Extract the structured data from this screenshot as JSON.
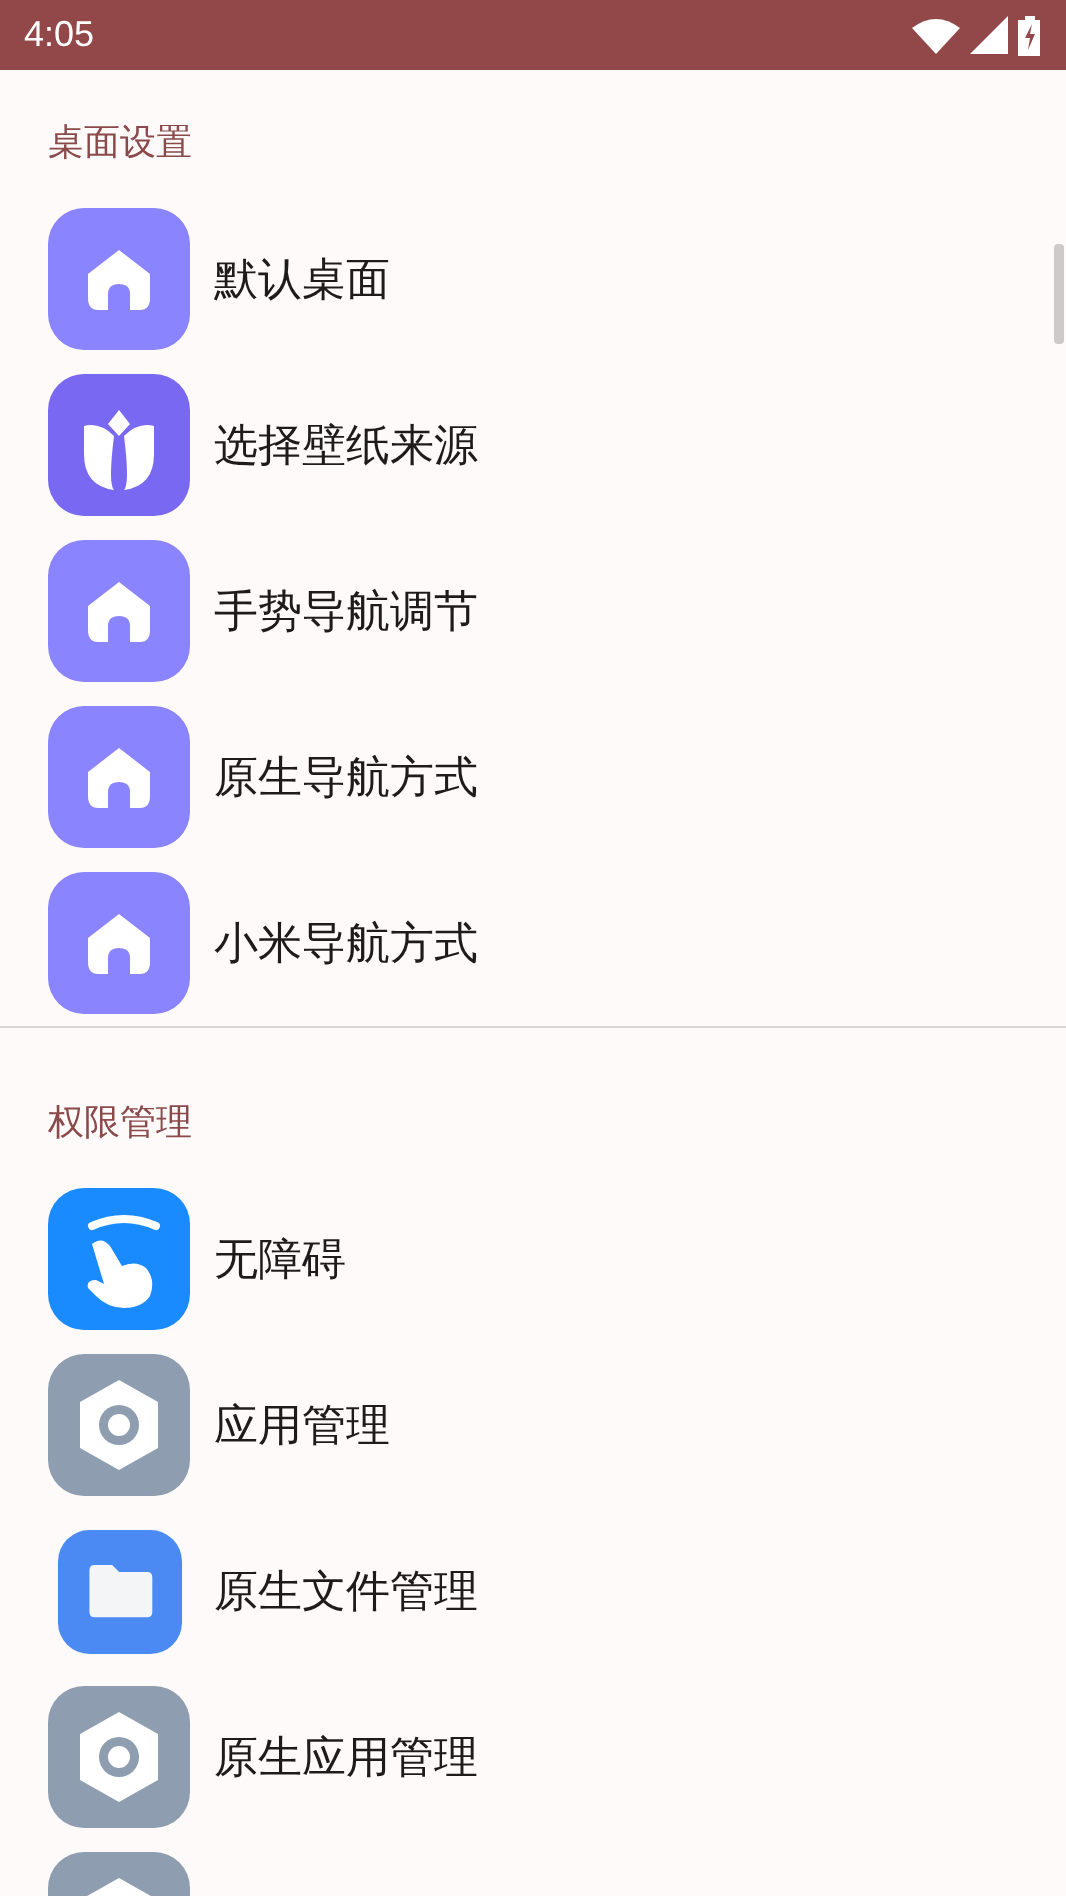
{
  "status_bar": {
    "time": "4:05"
  },
  "sections": [
    {
      "title": "桌面设置",
      "items": [
        {
          "label": "默认桌面",
          "kind": "home"
        },
        {
          "label": "选择壁纸来源",
          "kind": "tulip"
        },
        {
          "label": "手势导航调节",
          "kind": "home"
        },
        {
          "label": "原生导航方式",
          "kind": "home"
        },
        {
          "label": "小米导航方式",
          "kind": "home"
        }
      ]
    },
    {
      "title": "权限管理",
      "items": [
        {
          "label": "无障碍",
          "kind": "hand"
        },
        {
          "label": "应用管理",
          "kind": "gear"
        },
        {
          "label": "原生文件管理",
          "kind": "folder"
        },
        {
          "label": "原生应用管理",
          "kind": "gear"
        },
        {
          "kind": "gear"
        }
      ]
    }
  ]
}
